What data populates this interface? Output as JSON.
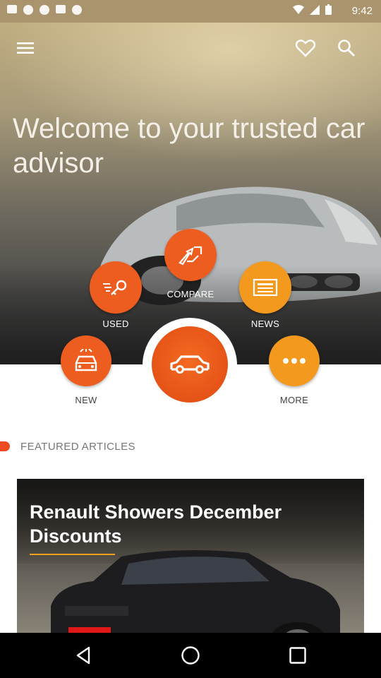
{
  "status_bar": {
    "time": "9:42"
  },
  "header": {
    "welcome_text": "Welcome to your trusted car advisor"
  },
  "actions": {
    "compare": "COMPARE",
    "used": "USED",
    "news": "NEWS",
    "new": "NEW",
    "more": "MORE"
  },
  "featured": {
    "heading": "FEATURED ARTICLES",
    "article_title": "Renault Showers December Discounts"
  },
  "icons": [
    "menu-icon",
    "heart-icon",
    "search-icon",
    "compare-icon",
    "key-icon",
    "newspaper-icon",
    "car-icon",
    "car-front-icon",
    "more-dots-icon",
    "back-icon",
    "home-icon",
    "recents-icon"
  ],
  "colors": {
    "accent_orange": "#ee5d20",
    "accent_amber": "#f39a1e",
    "featured_marker": "#ee4a1f"
  }
}
